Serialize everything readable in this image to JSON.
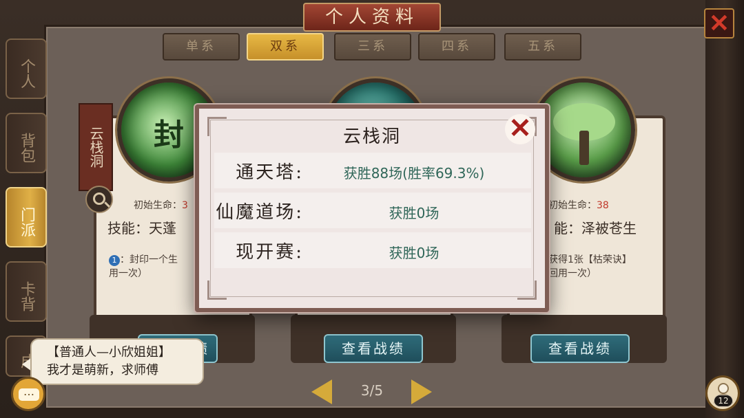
{
  "window": {
    "title": "个人资料",
    "close_symbol": "✕"
  },
  "side_tabs": [
    {
      "label": "个人",
      "active": false
    },
    {
      "label": "背包",
      "active": false
    },
    {
      "label": "门派",
      "active": true
    },
    {
      "label": "卡背",
      "active": false
    },
    {
      "label": "成",
      "active": false
    }
  ],
  "sect_tabs": [
    {
      "label": "单系",
      "active": false
    },
    {
      "label": "双系",
      "active": true
    },
    {
      "label": "三系",
      "active": false
    },
    {
      "label": "四系",
      "active": false
    },
    {
      "label": "五系",
      "active": false
    }
  ],
  "cards": {
    "left": {
      "sect_name": "云栈洞",
      "orb_char": "封",
      "life_label": "初始生命：",
      "life_value": "3",
      "skill": "技能：天蓬",
      "desc_badge": "1",
      "desc": "：封印一个生",
      "desc2": "用一次）",
      "icon": "search-icon"
    },
    "middle": {
      "record_button": "查看战绩"
    },
    "right": {
      "life_label": "初始生命：",
      "life_value": "38",
      "skill": "能：泽被苍生",
      "desc": "获得1张【枯荣诀】",
      "desc2": "回用一次）",
      "record_button": "查看战绩"
    }
  },
  "left_record_button": "查看战绩",
  "pager": {
    "text": "3/5"
  },
  "chat": {
    "line1": "【普通人—小欣姐姐】",
    "line2": "我才是萌新，求师傅",
    "icon": "chat-icon"
  },
  "friends": {
    "count": "12",
    "icon": "friends-icon"
  },
  "popup": {
    "title": "云栈洞",
    "close_symbol": "✕",
    "rows": [
      {
        "label": "通天塔:",
        "value": "获胜88场(胜率69.3%)"
      },
      {
        "label": "仙魔道场:",
        "value": "获胜0场"
      },
      {
        "label": "现开赛:",
        "value": "获胜0场"
      }
    ]
  },
  "colors": {
    "accent_gold": "#e0b047",
    "value_teal": "#2f6658",
    "close_red": "#a71f1c"
  }
}
